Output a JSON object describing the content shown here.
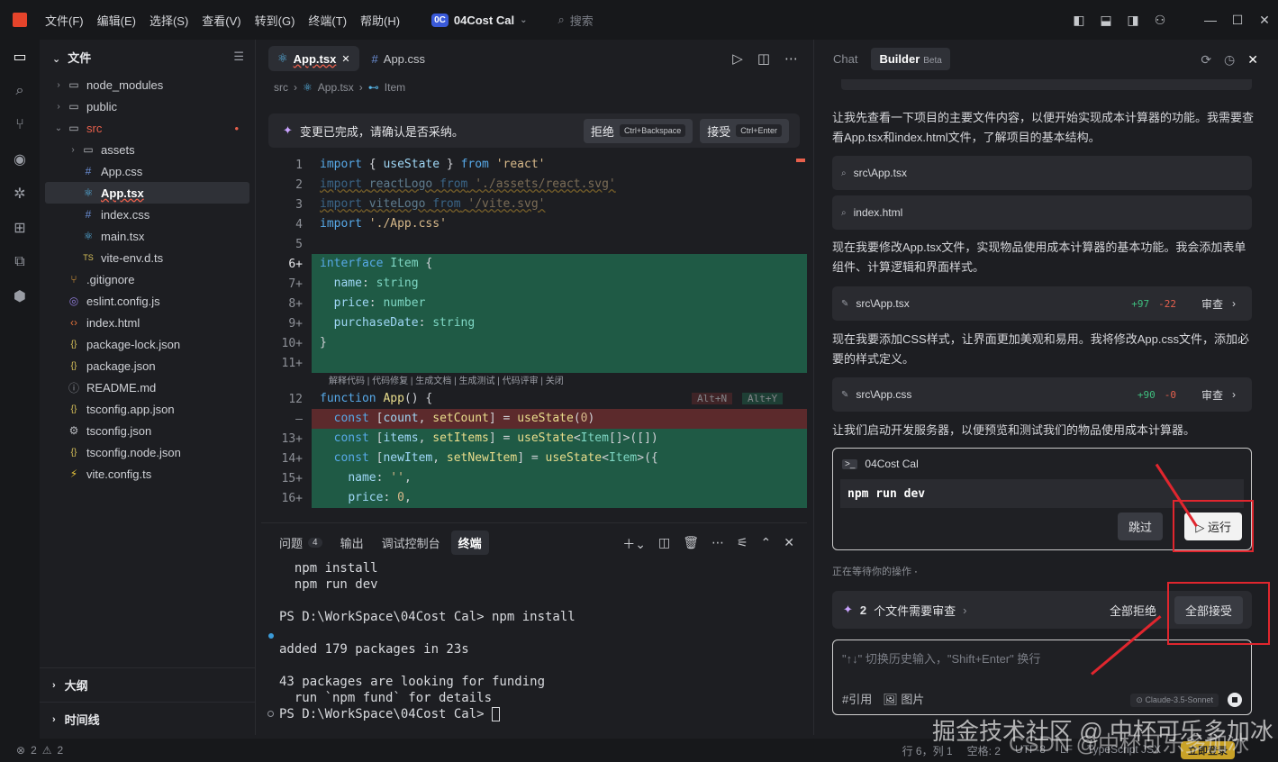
{
  "titlebar": {
    "menus": [
      "文件(F)",
      "编辑(E)",
      "选择(S)",
      "查看(V)",
      "转到(G)",
      "终端(T)",
      "帮助(H)"
    ],
    "project_badge": "0C",
    "project_name": "04Cost Cal",
    "search_placeholder": "搜索"
  },
  "explorer": {
    "title": "文件",
    "items": [
      {
        "label": "node_modules",
        "icon": "folder-icon",
        "chev": "›"
      },
      {
        "label": "public",
        "icon": "folder-icon",
        "chev": "›"
      },
      {
        "label": "src",
        "icon": "folder-open-icon",
        "chev": "⌄"
      },
      {
        "label": "assets",
        "icon": "folder-icon",
        "chev": "›"
      },
      {
        "label": "App.css",
        "icon": "hash-icon",
        "chev": ""
      },
      {
        "label": "App.tsx",
        "icon": "react-icon",
        "chev": ""
      },
      {
        "label": "index.css",
        "icon": "hash-icon",
        "chev": ""
      },
      {
        "label": "main.tsx",
        "icon": "react-icon",
        "chev": ""
      },
      {
        "label": "vite-env.d.ts",
        "icon": "ts-icon",
        "chev": ""
      },
      {
        "label": ".gitignore",
        "icon": "git-icon",
        "chev": ""
      },
      {
        "label": "eslint.config.js",
        "icon": "eslint-icon",
        "chev": ""
      },
      {
        "label": "index.html",
        "icon": "html-icon",
        "chev": ""
      },
      {
        "label": "package-lock.json",
        "icon": "json-icon",
        "chev": ""
      },
      {
        "label": "package.json",
        "icon": "json-icon",
        "chev": ""
      },
      {
        "label": "README.md",
        "icon": "info-icon",
        "chev": ""
      },
      {
        "label": "tsconfig.app.json",
        "icon": "json-icon",
        "chev": ""
      },
      {
        "label": "tsconfig.json",
        "icon": "gear-icon",
        "chev": ""
      },
      {
        "label": "tsconfig.node.json",
        "icon": "json-icon",
        "chev": ""
      },
      {
        "label": "vite.config.ts",
        "icon": "vite-icon",
        "chev": ""
      }
    ],
    "outline": "大纲",
    "timeline": "时间线"
  },
  "editor": {
    "tabs": [
      {
        "label": "App.tsx"
      },
      {
        "label": "App.css"
      }
    ],
    "breadcrumb": [
      "src",
      "App.tsx",
      "Item"
    ],
    "review_text": "变更已完成，请确认是否采纳。",
    "reject_label": "拒绝",
    "reject_kbd": "Ctrl+Backspace",
    "accept_label": "接受",
    "accept_kbd": "Ctrl+Enter",
    "hint": "解释代码 | 代码修复 | 生成文档 | 生成测试 | 代码评审 | 关闭",
    "alt_n": "Alt+N",
    "alt_y": "Alt+Y",
    "line_numbers": [
      "1",
      "2",
      "3",
      "4",
      "5",
      "6+",
      "7+",
      "8+",
      "9+",
      "10+",
      "11+",
      "12",
      "—",
      "13+",
      "14+",
      "15+",
      "16+"
    ]
  },
  "terminal": {
    "tabs": [
      "问题",
      "输出",
      "调试控制台",
      "终端"
    ],
    "problem_count": "4",
    "lines": [
      "  npm install",
      "  npm run dev",
      "",
      "PS D:\\WorkSpace\\04Cost Cal> npm install",
      "",
      "added 179 packages in 23s",
      "",
      "43 packages are looking for funding",
      "  run `npm fund` for details",
      "PS D:\\WorkSpace\\04Cost Cal> "
    ]
  },
  "panel": {
    "tab_chat": "Chat",
    "tab_builder": "Builder",
    "beta": "Beta",
    "p1": "让我先查看一下项目的主要文件内容，以便开始实现成本计算器的功能。我需要查看App.tsx和index.html文件，了解项目的基本结构。",
    "file1": "src\\App.tsx",
    "file2": "index.html",
    "p2": "现在我要修改App.tsx文件，实现物品使用成本计算器的基本功能。我会添加表单组件、计算逻辑和界面样式。",
    "edit1": {
      "file": "src\\App.tsx",
      "plus": "+97",
      "minus": "-22",
      "review": "审查"
    },
    "p3": "现在我要添加CSS样式，让界面更加美观和易用。我将修改App.css文件，添加必要的样式定义。",
    "edit2": {
      "file": "src\\App.css",
      "plus": "+90",
      "minus": "-0",
      "review": "审查"
    },
    "p4": "让我们启动开发服务器，以便预览和测试我们的物品使用成本计算器。",
    "run_title": "04Cost Cal",
    "run_cmd": "npm run dev",
    "skip": "跳过",
    "run": "运行",
    "waiting": "正在等待你的操作",
    "review_count": "2",
    "review_label": "个文件需要审查",
    "reject_all": "全部拒绝",
    "accept_all": "全部接受",
    "input_placeholder": "\"↑↓\" 切换历史输入，\"Shift+Enter\" 换行",
    "ref": "#引用",
    "image": "图片",
    "model": "Claude-3.5-Sonnet"
  },
  "status": {
    "errors": "2",
    "warnings": "2",
    "pos": "行 6，列 1",
    "indent": "空格: 2",
    "enc": "UTF-8",
    "eol": "LF",
    "lang": "TypeScript JSX",
    "upgrade": "立即登录"
  },
  "watermark": "掘金技术社区 @ 中杯可乐多加冰",
  "watermark2": "CSDN @中杯可乐多加冰"
}
